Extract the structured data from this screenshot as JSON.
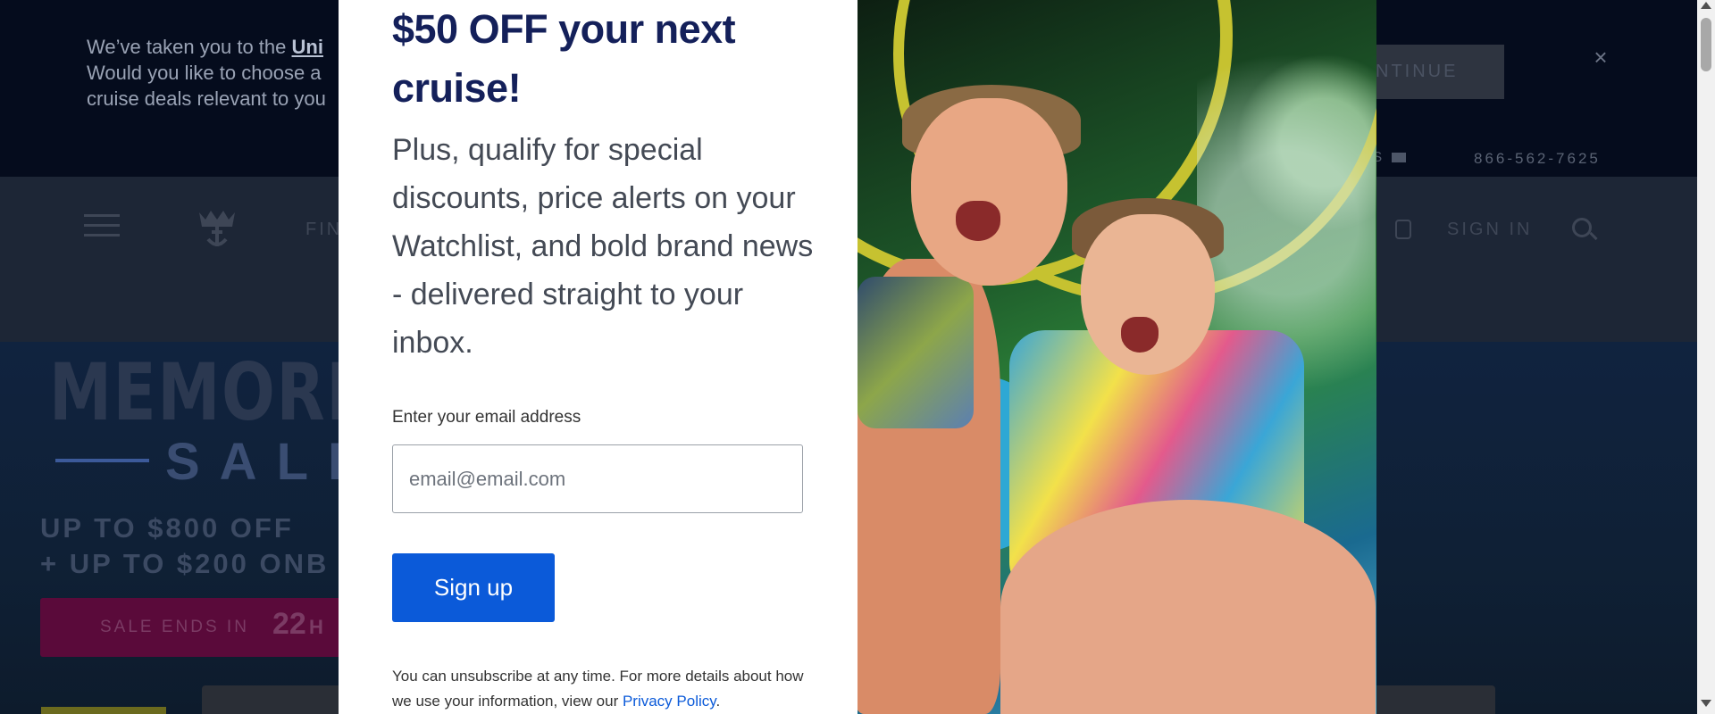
{
  "background_page": {
    "geo_banner": {
      "line1": "We’ve taken you to the ",
      "link": "Uni",
      "line2": "Would you like to choose a",
      "line3": "cruise deals relevant to you",
      "continue_label": "NTINUE",
      "close_icon": "close-icon"
    },
    "utility": {
      "country": "TES",
      "phone": "866-562-7625"
    },
    "nav": {
      "find_label": "FIN",
      "sign_in_label": "SIGN IN"
    },
    "hero": {
      "title_line1": "MEMORIAL",
      "title_line2": "SALE",
      "offer_line1": "UP TO $800 OFF",
      "offer_line2": "+ UP TO $200 ONB",
      "sale_ends_label": "SALE ENDS IN",
      "sale_ends_value": "22",
      "sale_ends_unit": "H"
    }
  },
  "modal": {
    "headline": "$50 OFF your next cruise!",
    "subheadline": "Plus, qualify for special discounts, price alerts on your Watchlist, and bold brand news - delivered straight to your inbox.",
    "email_label": "Enter your email address",
    "email_placeholder": "email@email.com",
    "email_value": "",
    "signup_label": "Sign up",
    "fine_print": "You can unsubscribe at any time. For more details about how we use your information, view our ",
    "privacy_link": "Privacy Policy",
    "fine_print_end": "."
  },
  "colors": {
    "brand_navy": "#14205a",
    "primary_button": "#0b5ad9",
    "link": "#0b5ad9"
  }
}
